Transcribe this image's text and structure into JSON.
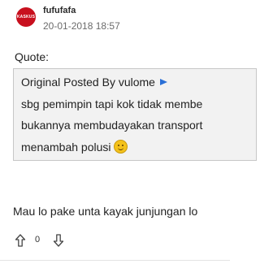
{
  "post": {
    "avatar": {
      "text": "KASKUS",
      "color": "#c8101e"
    },
    "username": "fufufafa",
    "timestamp": "20-01-2018 18:57",
    "quote_label": "Quote:",
    "quote": {
      "header": "Original Posted By vulome",
      "header_icon": "arrow-right-icon",
      "lines": [
        "sbg pemimpin tapi kok tidak membe",
        "bukannya membudayakan transport",
        "menambah polusi"
      ],
      "emoticon": "smiley-icon",
      "accent_color": "#2a6fd6"
    },
    "reply": "Mau lo pake unta kayak junjungan lo",
    "votes": {
      "count": "0",
      "up_icon": "arrow-up-icon",
      "down_icon": "arrow-down-icon"
    }
  }
}
